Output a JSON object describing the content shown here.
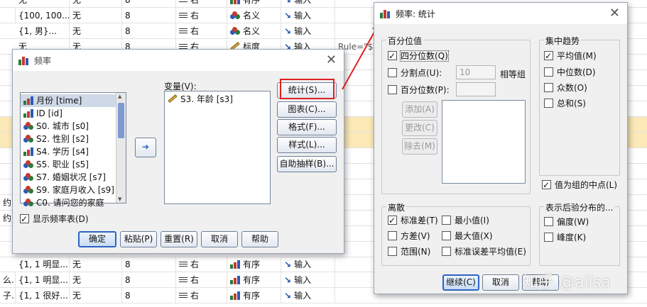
{
  "background": {
    "rows": [
      {
        "col1": "无",
        "col2": "无",
        "col3": "8",
        "align": "右",
        "measure": "有序",
        "role": "输入",
        "hl": false
      },
      {
        "col1": "",
        "col2": "{100, 100...",
        "col2b": "无",
        "col3": "8",
        "align": "右",
        "measure": "名义",
        "role": "输入",
        "hl": false
      },
      {
        "col1": "",
        "col2": "{1, 男}...",
        "col2b": "无",
        "col3": "8",
        "align": "右",
        "measure": "名义",
        "role": "输入",
        "hl": false
      },
      {
        "col1": "",
        "col2": "无",
        "col2b": "无",
        "col3": "8",
        "align": "右",
        "measure": "标度",
        "role": "输入",
        "extra": "Rule=\"$V",
        "hl": false
      },
      {
        "col1": "约...",
        "col2": "",
        "col2b": "",
        "col3": "",
        "align": "",
        "measure": "",
        "role": "",
        "hl": false
      },
      {
        "col1": "约...",
        "col2": "{1, 1 明显...",
        "col2b": "无",
        "col3": "8",
        "align": "右",
        "measure": "有序",
        "role": "输入",
        "hl": false
      },
      {
        "col1": "么...",
        "col2": "{1, 1 明显...",
        "col2b": "无",
        "col3": "8",
        "align": "右",
        "measure": "有序",
        "role": "输入",
        "hl": false
      },
      {
        "col1": "子...",
        "col2": "{1, 1 很好...",
        "col2b": "无",
        "col3": "8",
        "align": "右",
        "measure": "有序",
        "role": "输入",
        "hl": false
      }
    ]
  },
  "freq_dialog": {
    "title": "频率",
    "variables_label": "变量(V):",
    "source_items": [
      {
        "label": "月份 [time]",
        "icon": "bar"
      },
      {
        "label": "ID [id]",
        "icon": "bar"
      },
      {
        "label": "S0. 城市 [s0]",
        "icon": "nominal"
      },
      {
        "label": "S2. 性别 [s2]",
        "icon": "nominal"
      },
      {
        "label": "S4. 学历 [s4]",
        "icon": "bar"
      },
      {
        "label": "S5. 职业 [s5]",
        "icon": "nominal"
      },
      {
        "label": "S7. 婚姻状况 [s7]",
        "icon": "nominal"
      },
      {
        "label": "S9. 家庭月收入 [s9]",
        "icon": "nominal"
      },
      {
        "label": "C0. 请问您的家庭",
        "icon": "nominal"
      }
    ],
    "target_items": [
      {
        "label": "S3. 年龄 [s3]",
        "icon": "scale"
      }
    ],
    "side_buttons": [
      "统计(S)...",
      "图表(C)...",
      "格式(F)...",
      "样式(L)...",
      "自助抽样(B)..."
    ],
    "show_table_label": "显示频率表(D)",
    "show_table_checked": true,
    "bottom_buttons": [
      "确定",
      "粘贴(P)",
      "重置(R)",
      "取消",
      "帮助"
    ]
  },
  "stats_dialog": {
    "title": "频率: 统计",
    "percentile_group": {
      "title": "百分位值",
      "quartiles": {
        "label": "四分位数(Q)",
        "checked": true
      },
      "cutpoints": {
        "label": "分割点(U):",
        "value": "10",
        "suffix": "相等组",
        "checked": false
      },
      "percentiles": {
        "label": "百分位数(P):",
        "checked": false
      },
      "add": "添加(A)",
      "change": "更改(C)",
      "remove": "除去(M)"
    },
    "central_group": {
      "title": "集中趋势",
      "items": [
        {
          "label": "平均值(M)",
          "checked": true
        },
        {
          "label": "中位数(D)",
          "checked": false
        },
        {
          "label": "众数(O)",
          "checked": false
        },
        {
          "label": "总和(S)",
          "checked": false
        }
      ]
    },
    "midpoints": {
      "label": "值为组的中点(L)",
      "checked": true
    },
    "dispersion_group": {
      "title": "离散",
      "items": [
        {
          "label": "标准差(T)",
          "checked": true
        },
        {
          "label": "最小值(I)",
          "checked": false
        },
        {
          "label": "方差(V)",
          "checked": false
        },
        {
          "label": "最大值(X)",
          "checked": false
        },
        {
          "label": "范围(N)",
          "checked": false
        },
        {
          "label": "标准误差平均值(E)",
          "checked": false
        }
      ]
    },
    "distribution_group": {
      "title": "表示后验分布的...",
      "items": [
        {
          "label": "偏度(W)",
          "checked": false
        },
        {
          "label": "峰度(K)",
          "checked": false
        }
      ]
    },
    "buttons": [
      "继续(C)",
      "取消",
      "帮助"
    ]
  },
  "watermark": "知乎 @ailsa"
}
